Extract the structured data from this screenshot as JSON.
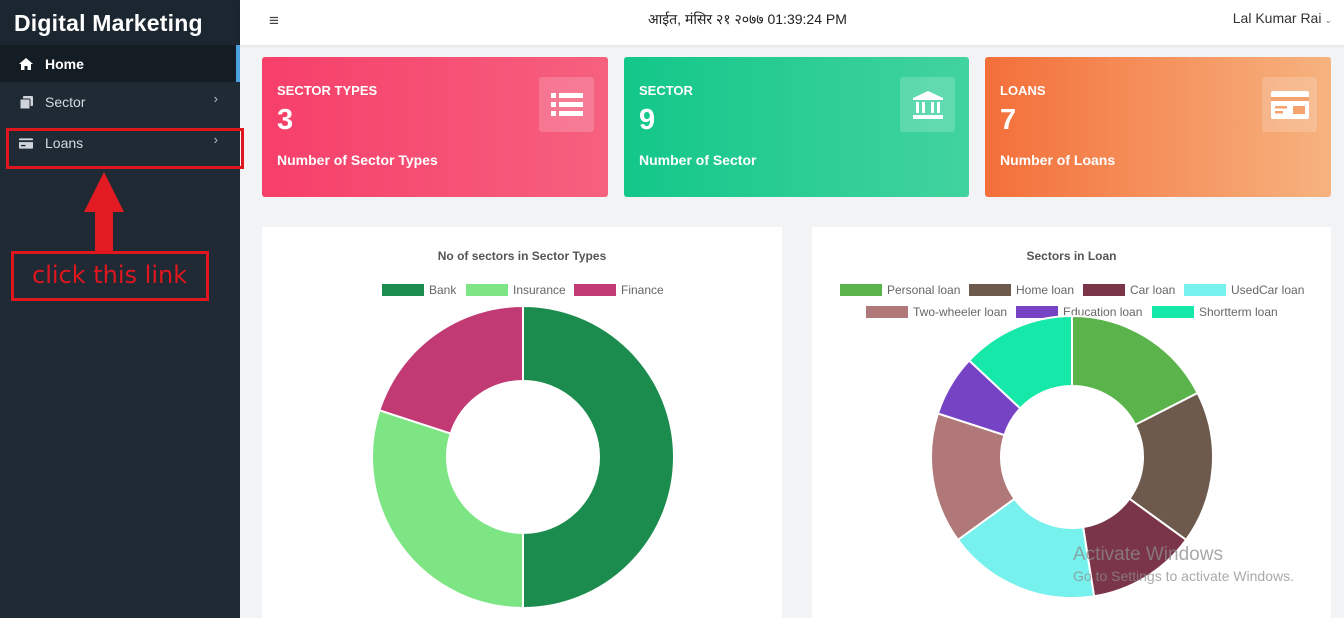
{
  "brand": "Digital Marketing",
  "sidebar": {
    "items": [
      {
        "label": "Home",
        "icon": "home-icon"
      },
      {
        "label": "Sector",
        "icon": "copy-icon",
        "chevron": "›"
      },
      {
        "label": "Loans",
        "icon": "card-icon",
        "chevron": "›"
      }
    ]
  },
  "annotation": {
    "text": "click this link",
    "color": "#e0161f"
  },
  "topbar": {
    "menu_icon": "≡",
    "datetime": "आईत, मंसिर २१ २०७७ 01:39:24 PM",
    "user": "Lal Kumar Rai",
    "user_caret": "⌄"
  },
  "cards": [
    {
      "title": "SECTOR TYPES",
      "value": "3",
      "subtitle": "Number of Sector Types",
      "icon": "list-icon",
      "color": "#f63f6a"
    },
    {
      "title": "SECTOR",
      "value": "9",
      "subtitle": "Number of Sector",
      "icon": "bank-icon",
      "color": "#13c789"
    },
    {
      "title": "LOANS",
      "value": "7",
      "subtitle": "Number of Loans",
      "icon": "card-icon",
      "color": "#f46f3a"
    }
  ],
  "chart_data": [
    {
      "type": "pie",
      "title": "No of sectors in Sector Types",
      "categories": [
        "Bank",
        "Insurance",
        "Finance"
      ],
      "values": [
        50,
        30,
        20
      ],
      "colors": [
        "#1b8c4d",
        "#7de584",
        "#c13a74"
      ],
      "legend": "top"
    },
    {
      "type": "pie",
      "title": "Sectors in Loan",
      "categories": [
        "Personal loan",
        "Home loan",
        "Car loan",
        "UsedCar loan",
        "Two-wheeler loan",
        "Education loan",
        "Shortterm loan"
      ],
      "values": [
        17.5,
        17.5,
        12.5,
        17.5,
        15,
        7,
        13
      ],
      "colors": [
        "#5bb34b",
        "#6d5a4c",
        "#7b3549",
        "#76f1ee",
        "#b07878",
        "#7743c5",
        "#16e8a9"
      ],
      "legend": "top"
    }
  ],
  "watermark": {
    "line1": "Activate Windows",
    "line2": "Go to Settings to activate Windows."
  }
}
